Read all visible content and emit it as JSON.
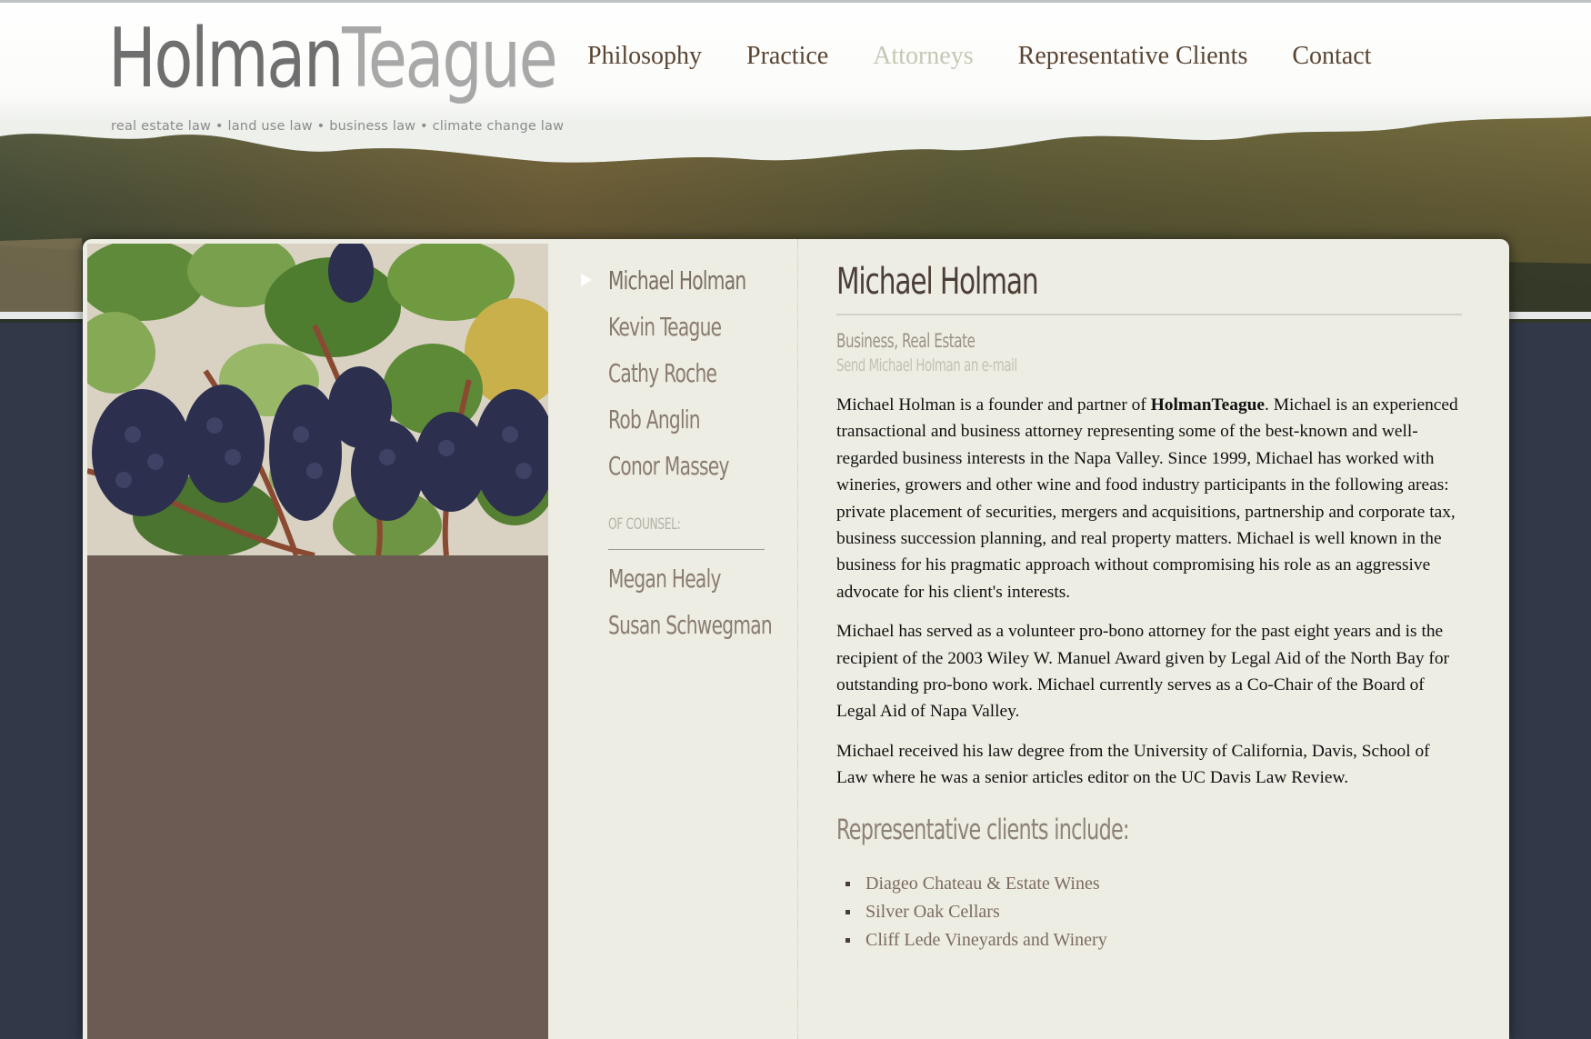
{
  "logo": {
    "part1": "Holman",
    "part2": "Teague"
  },
  "tagline": "real estate law • land use law • business law • climate change law",
  "nav": [
    {
      "label": "Philosophy",
      "active": false
    },
    {
      "label": "Practice",
      "active": false
    },
    {
      "label": "Attorneys",
      "active": true
    },
    {
      "label": "Representative Clients",
      "active": false
    },
    {
      "label": "Contact",
      "active": false
    }
  ],
  "attorneys": [
    "Michael Holman",
    "Kevin Teague",
    "Cathy Roche",
    "Rob Anglin",
    "Conor Massey"
  ],
  "of_counsel_label": "OF COUNSEL:",
  "of_counsel": [
    "Megan Healy",
    "Susan Schwegman"
  ],
  "profile": {
    "name": "Michael Holman",
    "practice_areas": "Business, Real Estate",
    "email_link": "Send Michael Holman an e-mail",
    "bio": [
      {
        "pre": "Michael Holman is a founder and partner of ",
        "bold": "HolmanTeague",
        "post": ". Michael is an experienced transactional and business attorney representing some of the best-known and well-regarded business interests in the Napa Valley. Since 1999, Michael has worked with wineries, growers and other wine and food industry participants in the following areas: private placement of securities, mergers and acquisitions, partnership and corporate tax, business succession planning, and real property matters. Michael is well known in the business for his pragmatic approach without compromising his role as an aggressive advocate for his client's interests."
      },
      {
        "text": "Michael has served as a volunteer pro-bono attorney for the past eight years and is the recipient of the 2003 Wiley W. Manuel Award given by Legal Aid of the North Bay for outstanding pro-bono work. Michael currently serves as a Co-Chair of the Board of Legal Aid of Napa Valley."
      },
      {
        "text": "Michael received his law degree from the University of California, Davis, School of Law where he was a senior articles editor on the UC Davis Law Review."
      }
    ],
    "clients_heading": "Representative clients include:",
    "clients": [
      "Diageo Chateau & Estate Wines",
      "Silver Oak Cellars",
      "Cliff Lede Vineyards and Winery"
    ]
  },
  "colors": {
    "background": "#323848",
    "panel": "#edede3",
    "nav_text": "#5a4533",
    "nav_active": "#c5c7b3",
    "sidebar_brown": "#6b5b52"
  },
  "icons": {
    "current_attorney": "white-triangle-arrow-icon"
  }
}
